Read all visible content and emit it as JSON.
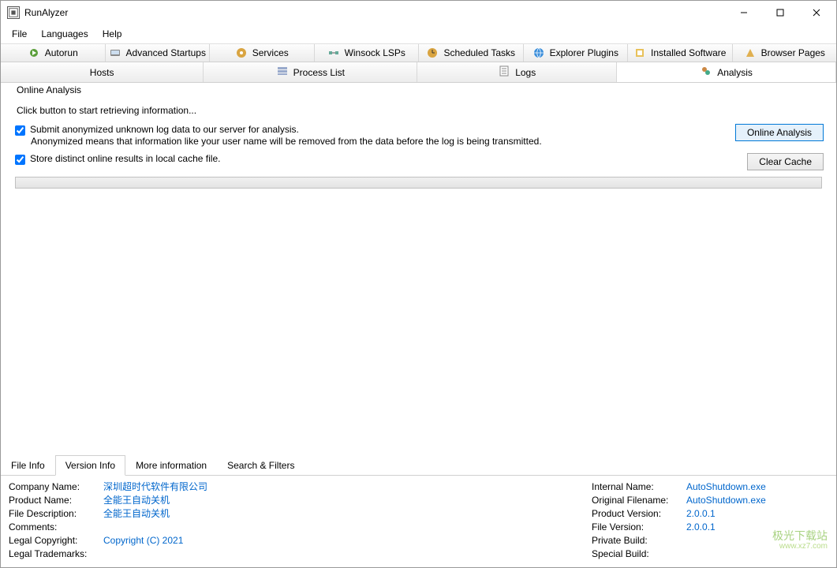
{
  "window": {
    "title": "RunAlyzer"
  },
  "menu": {
    "file": "File",
    "languages": "Languages",
    "help": "Help"
  },
  "tabs": {
    "autorun": "Autorun",
    "advanced_startups": "Advanced Startups",
    "services": "Services",
    "winsock": "Winsock LSPs",
    "scheduled": "Scheduled Tasks",
    "explorer_plugins": "Explorer Plugins",
    "installed_software": "Installed Software",
    "browser_pages": "Browser Pages"
  },
  "tabs2": {
    "hosts": "Hosts",
    "process_list": "Process List",
    "logs": "Logs",
    "analysis": "Analysis"
  },
  "group": {
    "title": "Online Analysis",
    "instruction": "Click button to start retrieving information...",
    "submit_label": "Submit anonymized unknown log data to our server for analysis.",
    "submit_desc": "Anonymized means that information like your user name will be removed from the data before the log is being transmitted.",
    "cache_label": "Store distinct online results in local cache file.",
    "online_btn": "Online Analysis",
    "clear_btn": "Clear Cache"
  },
  "bottom_tabs": {
    "file_info": "File Info",
    "version_info": "Version Info",
    "more_info": "More information",
    "search_filters": "Search & Filters"
  },
  "version_info": {
    "left": {
      "company_name_label": "Company Name:",
      "company_name_value": "深圳超时代软件有限公司",
      "product_name_label": "Product Name:",
      "product_name_value": "全能王自动关机",
      "file_description_label": "File Description:",
      "file_description_value": "全能王自动关机",
      "comments_label": "Comments:",
      "comments_value": "",
      "legal_copyright_label": "Legal Copyright:",
      "legal_copyright_value": "Copyright (C) 2021",
      "legal_trademarks_label": "Legal Trademarks:",
      "legal_trademarks_value": ""
    },
    "right": {
      "internal_name_label": "Internal Name:",
      "internal_name_value": "AutoShutdown.exe",
      "original_filename_label": "Original Filename:",
      "original_filename_value": "AutoShutdown.exe",
      "product_version_label": "Product Version:",
      "product_version_value": "2.0.0.1",
      "file_version_label": "File Version:",
      "file_version_value": "2.0.0.1",
      "private_build_label": "Private Build:",
      "private_build_value": "",
      "special_build_label": "Special Build:",
      "special_build_value": ""
    }
  },
  "watermark": {
    "line1": "极光下载站",
    "line2": "www.xz7.com"
  }
}
